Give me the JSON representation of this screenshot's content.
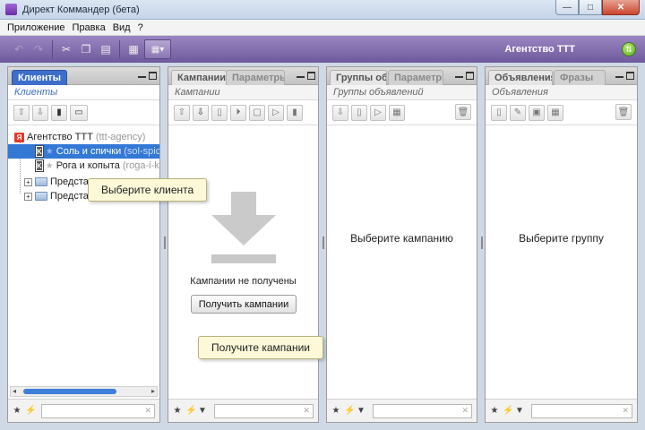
{
  "window": {
    "title": "Директ Коммандер (бета)",
    "min": "—",
    "max": "□",
    "close": "✕"
  },
  "menu": [
    "Приложение",
    "Правка",
    "Вид",
    "?"
  ],
  "toolbar": {
    "agency_name": "Агентство ТТТ",
    "network_icon": "network-status-icon"
  },
  "panels": {
    "clients": {
      "tab": "Клиенты",
      "subtitle": "Клиенты",
      "tree": {
        "agency": {
          "name": "Агентство ТТТ",
          "login": "(ttt-agency)"
        },
        "clients": [
          {
            "name": "Соль и спички",
            "login": "(sol-spich"
          },
          {
            "name": "Рога и копыта",
            "login": "(roga-i-ko"
          }
        ],
        "folders": [
          "Представ",
          "Представ"
        ]
      }
    },
    "campaigns": {
      "tabs": [
        "Кампании",
        "Параметры"
      ],
      "subtitle": "Кампании",
      "empty_text": "Кампании не получены",
      "get_button": "Получить кампании"
    },
    "groups": {
      "tabs": [
        "Группы об...",
        "Параметры"
      ],
      "subtitle": "Группы объявлений",
      "placeholder": "Выберите кампанию"
    },
    "ads": {
      "tabs": [
        "Объявления",
        "Фразы"
      ],
      "subtitle": "Объявления",
      "placeholder": "Выберите группу"
    }
  },
  "tooltips": {
    "select_client": "Выберите клиента",
    "get_campaigns": "Получите кампании"
  },
  "colors": {
    "toolbar": "#7d68ab",
    "selection": "#3478d6",
    "tab_active": "#3d6ec9",
    "tooltip_bg": "#fdf9d8"
  }
}
